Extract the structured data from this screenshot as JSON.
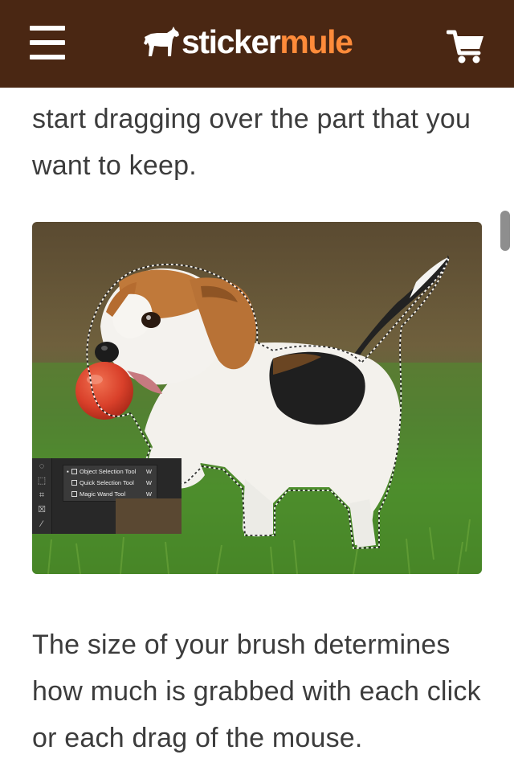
{
  "header": {
    "logo_word1": "sticker",
    "logo_word2": "mule",
    "menu_icon": "hamburger-menu-icon",
    "cart_icon": "shopping-cart-icon",
    "background": "#4a2713",
    "accent": "#ff8b3a"
  },
  "article": {
    "paragraph_top": "start dragging over the part that you want to keep.",
    "paragraph_bottom": "The size of your brush determines how much is grabbed with each click or each drag of the mouse."
  },
  "photo": {
    "subject": "beagle puppy with red ball, selection outline",
    "tool_menu": {
      "items": [
        {
          "label": "Object Selection Tool",
          "shortcut": "W",
          "active": true
        },
        {
          "label": "Quick Selection Tool",
          "shortcut": "W",
          "active": false
        },
        {
          "label": "Magic Wand Tool",
          "shortcut": "W",
          "active": false
        }
      ],
      "sidebar_icons": [
        "lasso-icon",
        "selection-tool-icon",
        "crop-icon",
        "frame-icon",
        "eyedropper-icon"
      ]
    }
  }
}
